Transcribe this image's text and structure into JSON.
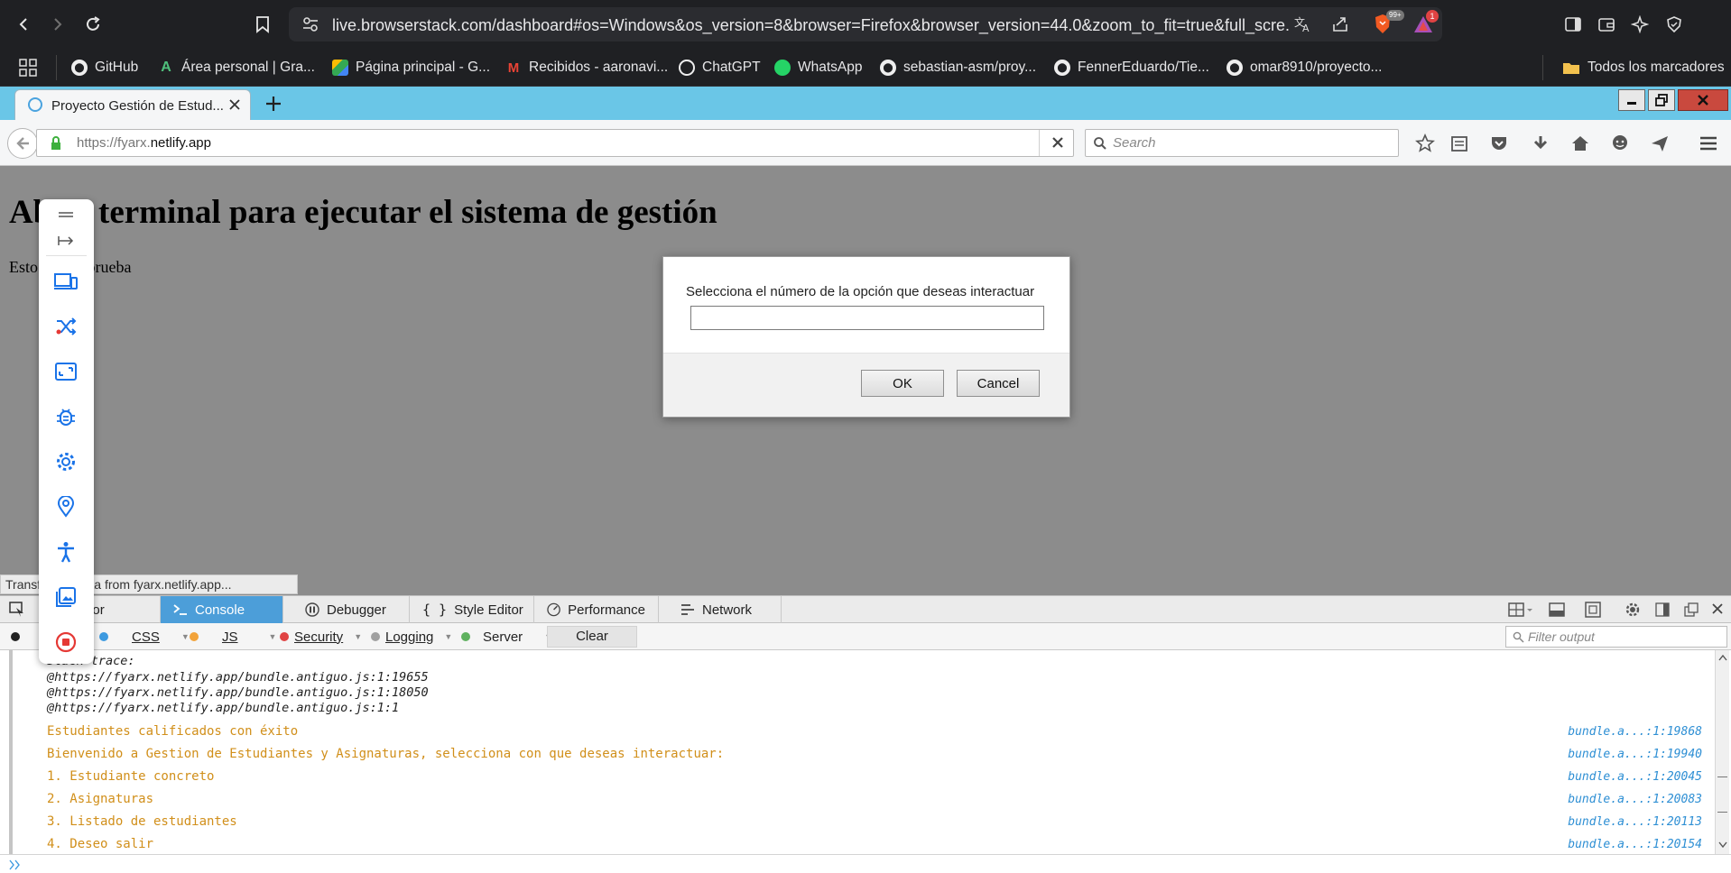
{
  "outer_browser": {
    "url": "live.browserstack.com/dashboard#os=Windows&os_version=8&browser=Firefox&browser_version=44.0&zoom_to_fit=true&full_scre...",
    "brave_badge": "99+",
    "alert_badge": "1",
    "bookmarks": [
      {
        "label": "GitHub",
        "icon": "github-icon"
      },
      {
        "label": "Área personal | Gra...",
        "icon": "a-logo-icon"
      },
      {
        "label": "Página principal - G...",
        "icon": "google-drive-icon"
      },
      {
        "label": "Recibidos - aaronavi...",
        "icon": "gmail-icon"
      },
      {
        "label": "ChatGPT",
        "icon": "chatgpt-icon"
      },
      {
        "label": "WhatsApp",
        "icon": "whatsapp-icon"
      },
      {
        "label": "sebastian-asm/proy...",
        "icon": "github-icon"
      },
      {
        "label": "FennerEduardo/Tie...",
        "icon": "github-icon"
      },
      {
        "label": "omar8910/proyecto...",
        "icon": "github-icon"
      }
    ],
    "all_bookmarks": "Todos los marcadores"
  },
  "firefox": {
    "tab_title": "Proyecto Gestión de Estud...",
    "url_prefix": "https://fyarx.",
    "url_domain": "netlify.app",
    "search_placeholder": "Search"
  },
  "page": {
    "heading": "Abrir terminal para ejecutar el sistema de gestión",
    "paragraph": "Esto es una prueba"
  },
  "dialog": {
    "message": "Selecciona el número de la opción que deseas interactuar",
    "input_value": "",
    "ok_label": "OK",
    "cancel_label": "Cancel"
  },
  "status_text": "Transferring data from fyarx.netlify.app...",
  "devtools": {
    "tabs": [
      "Inspector",
      "Console",
      "Debugger",
      "Style Editor",
      "Performance",
      "Network"
    ],
    "active_tab": "Console",
    "filters": [
      {
        "label": "CSS",
        "color": "#3d9ae0"
      },
      {
        "label": "JS",
        "color": "#f2a33a"
      },
      {
        "label": "Security",
        "color": "#e04343"
      },
      {
        "label": "Logging",
        "color": "#a0a0a0"
      },
      {
        "label": "Server",
        "color": "#5fb15f"
      }
    ],
    "clear_label": "Clear",
    "filter_placeholder": "Filter output",
    "trace_lines": [
      "Stack trace:",
      "@https://fyarx.netlify.app/bundle.antiguo.js:1:19655",
      "@https://fyarx.netlify.app/bundle.antiguo.js:1:18050",
      "@https://fyarx.netlify.app/bundle.antiguo.js:1:1"
    ],
    "log_lines": [
      {
        "text": "Estudiantes calificados con éxito",
        "loc": "bundle.a...:1:19868"
      },
      {
        "text": "Bienvenido a Gestion de Estudiantes y Asignaturas, selecciona con que deseas interactuar:",
        "loc": "bundle.a...:1:19940"
      },
      {
        "text": "1. Estudiante concreto",
        "loc": "bundle.a...:1:20045"
      },
      {
        "text": "2. Asignaturas",
        "loc": "bundle.a...:1:20083"
      },
      {
        "text": "3. Listado de estudiantes",
        "loc": "bundle.a...:1:20113"
      },
      {
        "text": "4. Deseo salir",
        "loc": "bundle.a...:1:20154"
      }
    ]
  }
}
